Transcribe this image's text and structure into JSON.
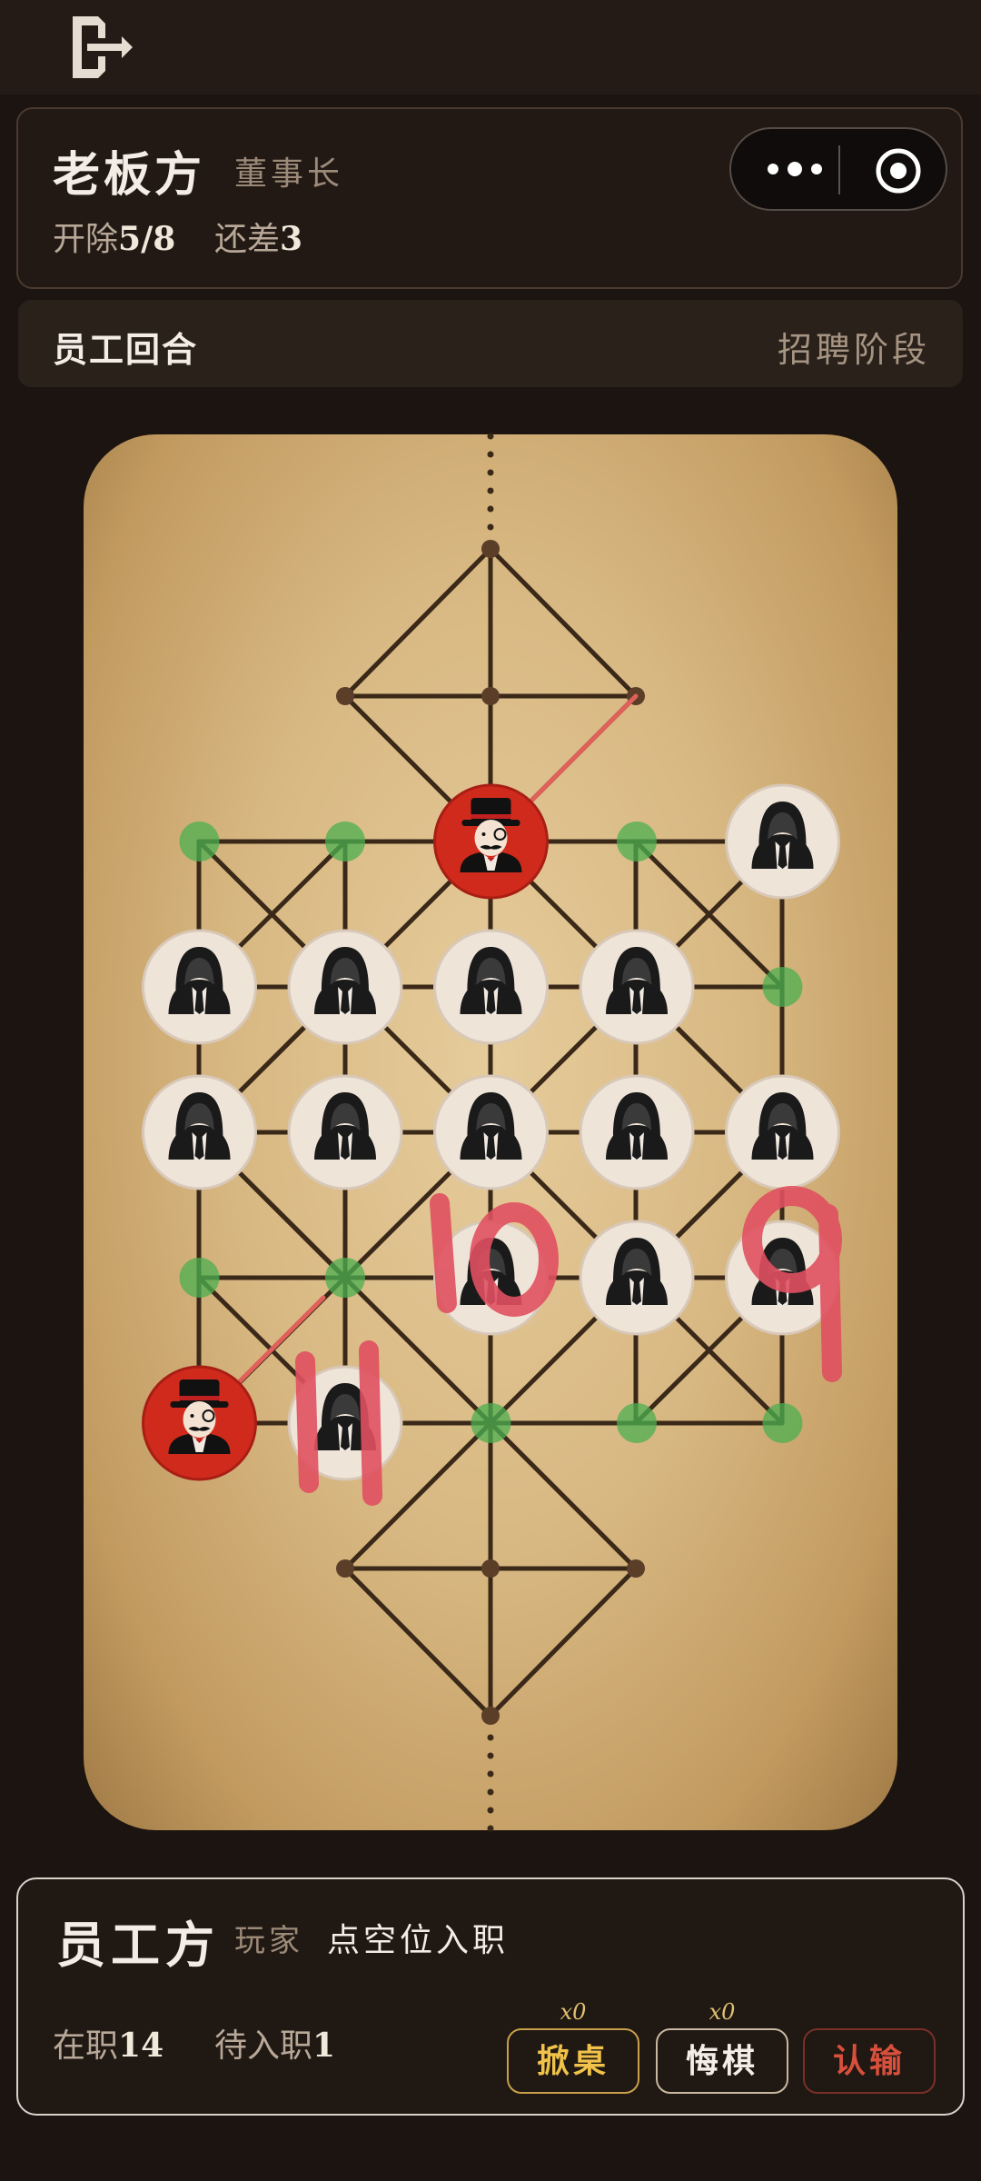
{
  "header": {
    "exit_icon": "exit-door-icon"
  },
  "boss": {
    "title": "老板方",
    "role": "董事长",
    "fired_label": "开除",
    "fired_value": "5/8",
    "remaining_label": "还差",
    "remaining_value": "3"
  },
  "capsule": {
    "more_icon": "more-dots-icon",
    "target_icon": "target-icon"
  },
  "turn": {
    "left": "员工回合",
    "right": "招聘阶段"
  },
  "annotations": [
    "10",
    "9",
    "11"
  ],
  "employee": {
    "title": "员工方",
    "role": "玩家",
    "hint": "点空位入职",
    "onduty_label": "在职",
    "onduty_value": "14",
    "pending_label": "待入职",
    "pending_value": "1"
  },
  "buttons": {
    "flip": {
      "label": "掀桌",
      "count": "x0"
    },
    "undo": {
      "label": "悔棋",
      "count": "x0"
    },
    "quit": {
      "label": "认输"
    }
  },
  "colors": {
    "boss_piece": "#d02a1c",
    "employee_piece": "#efe4d8",
    "valid_move": "#4caf50",
    "annotation": "#e05060",
    "last_move": "#e0605a"
  },
  "board": {
    "columns": 5,
    "pieces": [
      {
        "type": "boss",
        "col": 2,
        "row": 2
      },
      {
        "type": "employee",
        "col": 4,
        "row": 2
      },
      {
        "type": "employee",
        "col": 0,
        "row": 3
      },
      {
        "type": "employee",
        "col": 1,
        "row": 3
      },
      {
        "type": "employee",
        "col": 2,
        "row": 3
      },
      {
        "type": "employee",
        "col": 3,
        "row": 3
      },
      {
        "type": "employee",
        "col": 0,
        "row": 4
      },
      {
        "type": "employee",
        "col": 1,
        "row": 4
      },
      {
        "type": "employee",
        "col": 2,
        "row": 4
      },
      {
        "type": "employee",
        "col": 3,
        "row": 4
      },
      {
        "type": "employee",
        "col": 4,
        "row": 4
      },
      {
        "type": "employee",
        "col": 2,
        "row": 5
      },
      {
        "type": "employee",
        "col": 3,
        "row": 5
      },
      {
        "type": "employee",
        "col": 4,
        "row": 5
      },
      {
        "type": "boss",
        "col": 0,
        "row": 6
      },
      {
        "type": "employee",
        "col": 1,
        "row": 6
      }
    ],
    "valid_moves": [
      {
        "col": 0,
        "row": 2
      },
      {
        "col": 1,
        "row": 2
      },
      {
        "col": 3,
        "row": 2
      },
      {
        "col": 4,
        "row": 3
      },
      {
        "col": 0,
        "row": 5
      },
      {
        "col": 1,
        "row": 5
      },
      {
        "col": 2,
        "row": 6
      },
      {
        "col": 3,
        "row": 6
      },
      {
        "col": 4,
        "row": 6
      }
    ]
  }
}
